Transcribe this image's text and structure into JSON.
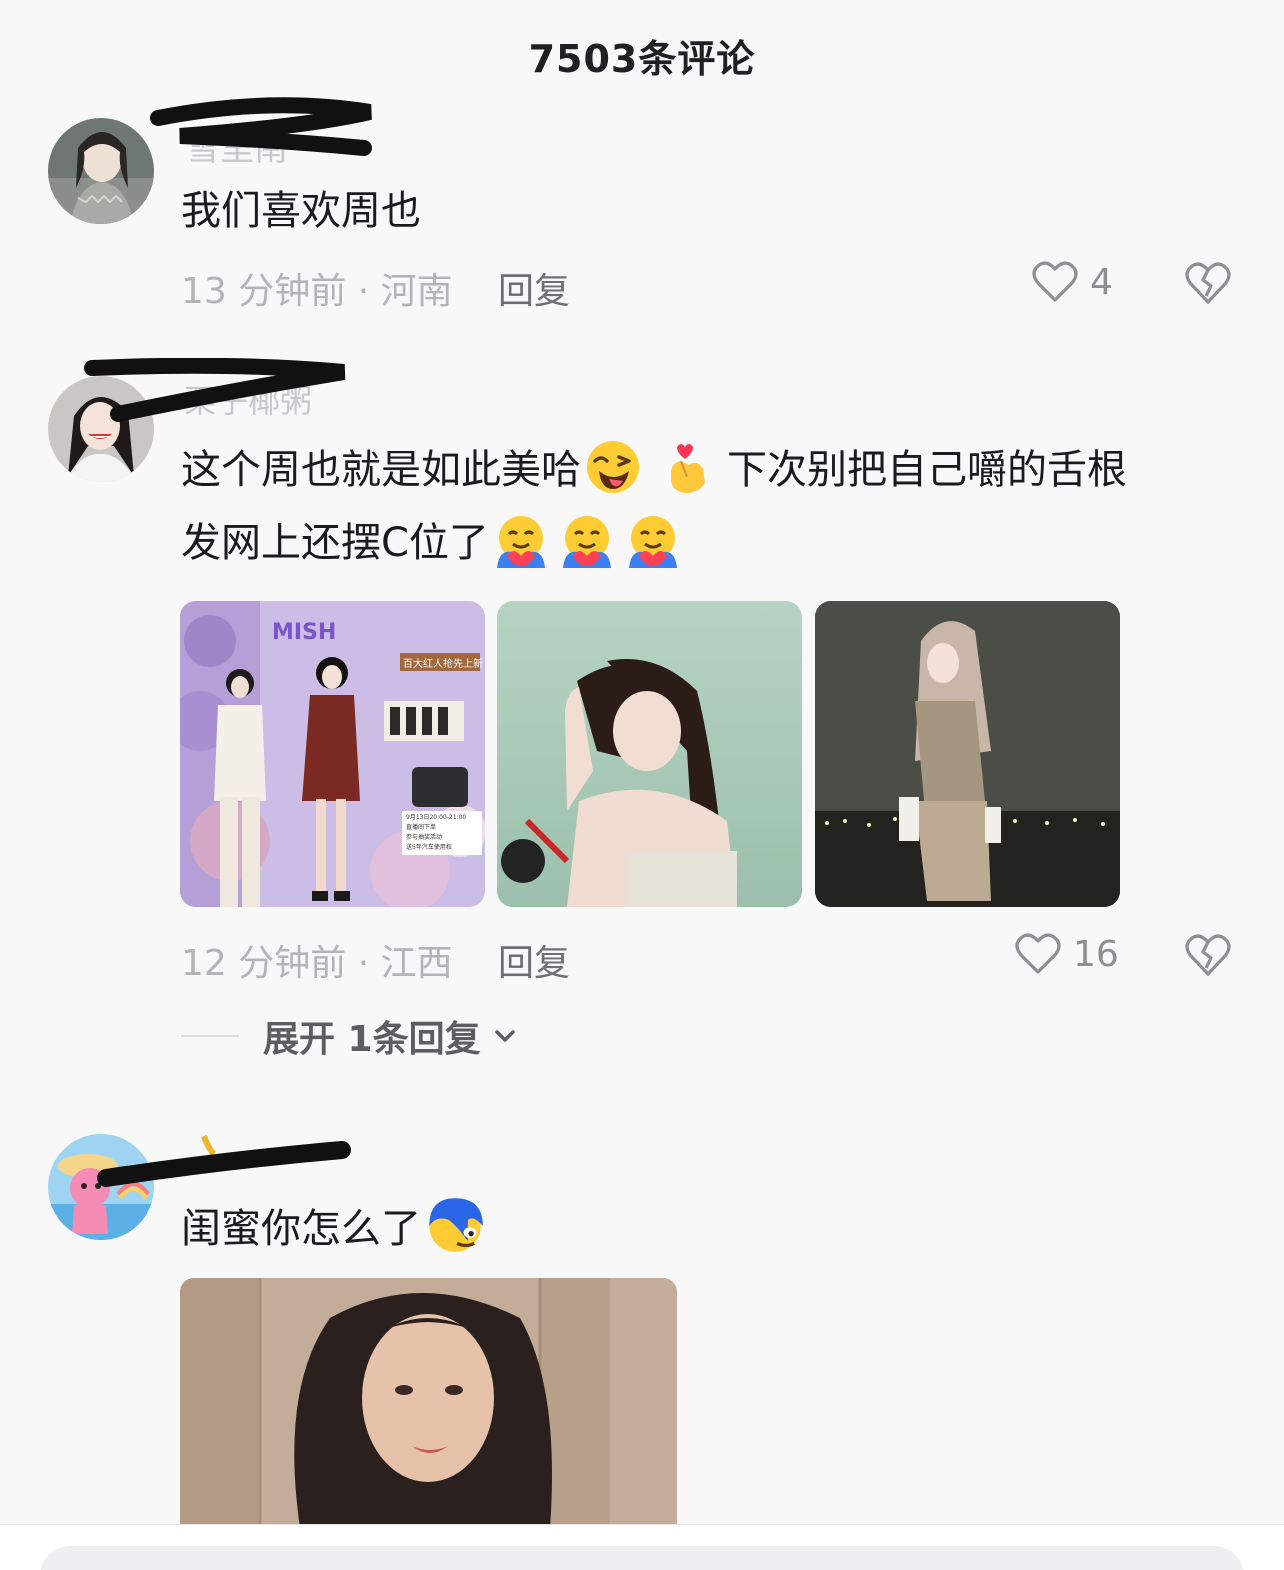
{
  "header": {
    "title": "7503条评论"
  },
  "comments": [
    {
      "username": "雪里南",
      "text": "我们喜欢周也",
      "time": "13 分钟前 · 河南",
      "reply_label": "回复",
      "likes": "4"
    },
    {
      "username": "栗子椰粥",
      "text_part1": "这个周也就是如此美哈",
      "text_part2": "下次别把自己嚼的舌根",
      "text_line2": "发网上还摆C位了",
      "time": "12 分钟前 · 江西",
      "reply_label": "回复",
      "likes": "16",
      "expand_label": "展开 1条回复",
      "photo_texts": {
        "brand": "MISH",
        "banner": "百大红人抢先上新",
        "promo_date": "9月13日20:00-21:00",
        "promo_l1": "直播间下单",
        "promo_l2": "参与抽奖活动",
        "promo_l3": "送5年汽车使用权"
      }
    },
    {
      "username": "",
      "text": "闺蜜你怎么了"
    }
  ],
  "icons": {
    "like": "heart-outline-icon",
    "dislike": "broken-heart-icon",
    "expand": "chevron-down-icon"
  },
  "colors": {
    "background": "#f8f8f9",
    "meta": "#b3b3b8",
    "text": "#1b1b1f"
  }
}
